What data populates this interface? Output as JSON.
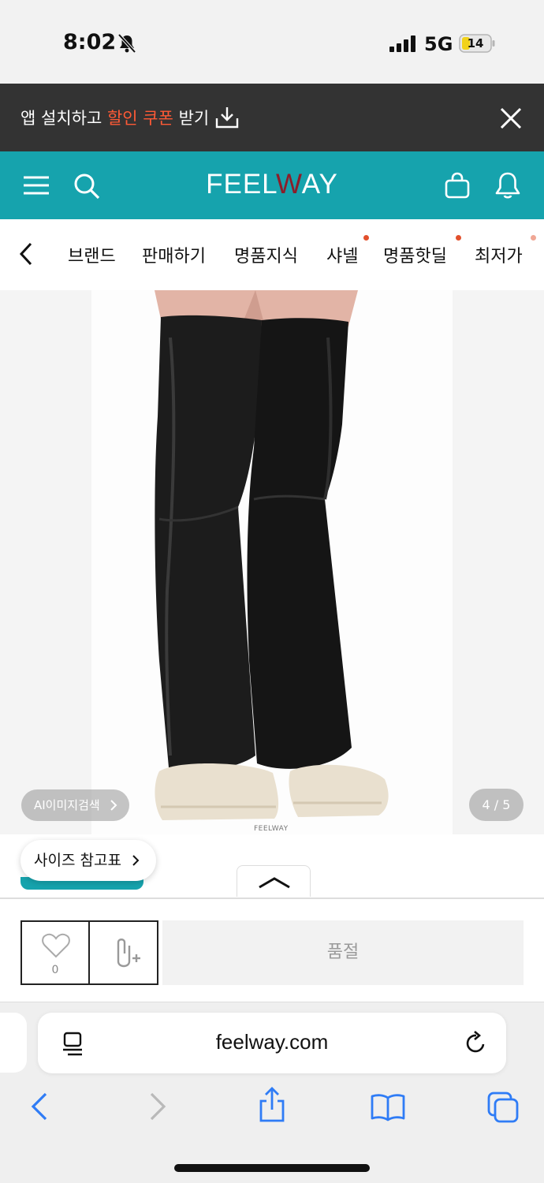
{
  "status": {
    "time": "8:02",
    "network": "5G",
    "battery": "14",
    "icons": [
      "bell-slash-icon",
      "signal-icon",
      "battery-charging-icon"
    ]
  },
  "banner": {
    "text_before": "앱 설치하고 ",
    "highlight": "할인 쿠폰",
    "text_after": " 받기",
    "highlight_color": "#ff5a36"
  },
  "header": {
    "logo_part1": "FEEL",
    "logo_w": "W",
    "logo_part2": "AY",
    "brand_color": "#16a3ad",
    "icons": [
      "menu-icon",
      "search-icon",
      "shopping-bag-icon",
      "bell-icon"
    ]
  },
  "nav": {
    "items": [
      {
        "label": "브랜드",
        "dot": false
      },
      {
        "label": "판매하기",
        "dot": false
      },
      {
        "label": "명품지식",
        "dot": false
      },
      {
        "label": "샤넬",
        "dot": true
      },
      {
        "label": "명품핫딜",
        "dot": true
      },
      {
        "label": "최저가",
        "dot": true
      }
    ]
  },
  "gallery": {
    "watermark": "FEELWAY",
    "ai_search_label": "AI이미지검색",
    "counter": "4 / 5"
  },
  "size_chart": {
    "label": "사이즈 참고표"
  },
  "actions": {
    "like_count": "0",
    "soldout_label": "품절"
  },
  "browser": {
    "url": "feelway.com",
    "toolbar": [
      "back-icon",
      "forward-icon",
      "share-icon",
      "bookmarks-icon",
      "tabs-icon"
    ]
  }
}
